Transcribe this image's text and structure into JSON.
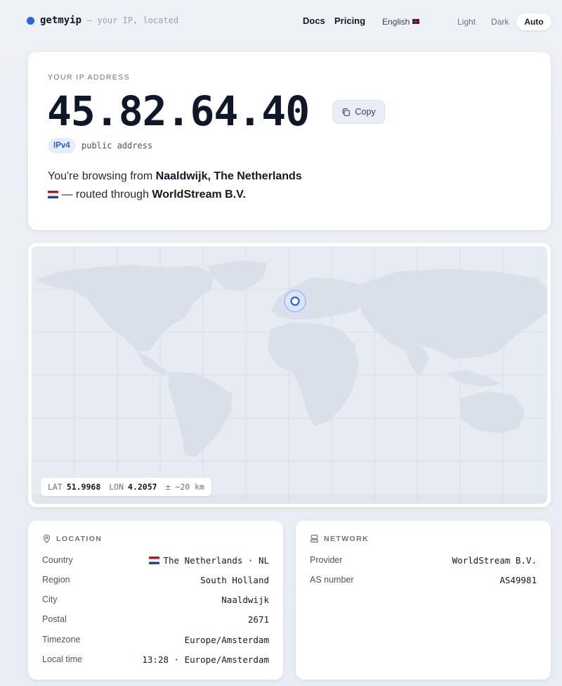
{
  "header": {
    "brand": "getmyip",
    "tagline": "— your IP, located",
    "nav": {
      "docs": "Docs",
      "pricing": "Pricing"
    },
    "language": "English",
    "theme": {
      "light": "Light",
      "dark": "Dark",
      "auto": "Auto",
      "selected": "Auto"
    }
  },
  "ip": {
    "label": "YOUR IP ADDRESS",
    "address": "45.82.64.40",
    "copy_label": "Copy",
    "version": "IPv4",
    "type_text": "public address",
    "browse_prefix": "You're browsing from ",
    "city_country": "Naaldwijk, The Netherlands",
    "routed_text": " — routed through ",
    "provider": "WorldStream B.V."
  },
  "map": {
    "lat_label": "LAT",
    "lat": "51.9968",
    "lon_label": "LON",
    "lon": "4.2057",
    "accuracy": "± ~20 km",
    "marker_color": "#2563eb"
  },
  "location": {
    "title": "LOCATION",
    "rows": [
      {
        "key": "Country",
        "value": "The Netherlands · NL"
      },
      {
        "key": "Region",
        "value": "South Holland"
      },
      {
        "key": "City",
        "value": "Naaldwijk"
      },
      {
        "key": "Postal",
        "value": "2671"
      },
      {
        "key": "Timezone",
        "value": "Europe/Amsterdam"
      },
      {
        "key": "Local time",
        "value": "13:28 · Europe/Amsterdam"
      }
    ]
  },
  "network": {
    "title": "NETWORK",
    "rows": [
      {
        "key": "Provider",
        "value": "WorldStream B.V."
      },
      {
        "key": "AS number",
        "value": "AS49981"
      }
    ]
  },
  "colors": {
    "accent": "#2563eb",
    "background": "#eef1f6"
  }
}
